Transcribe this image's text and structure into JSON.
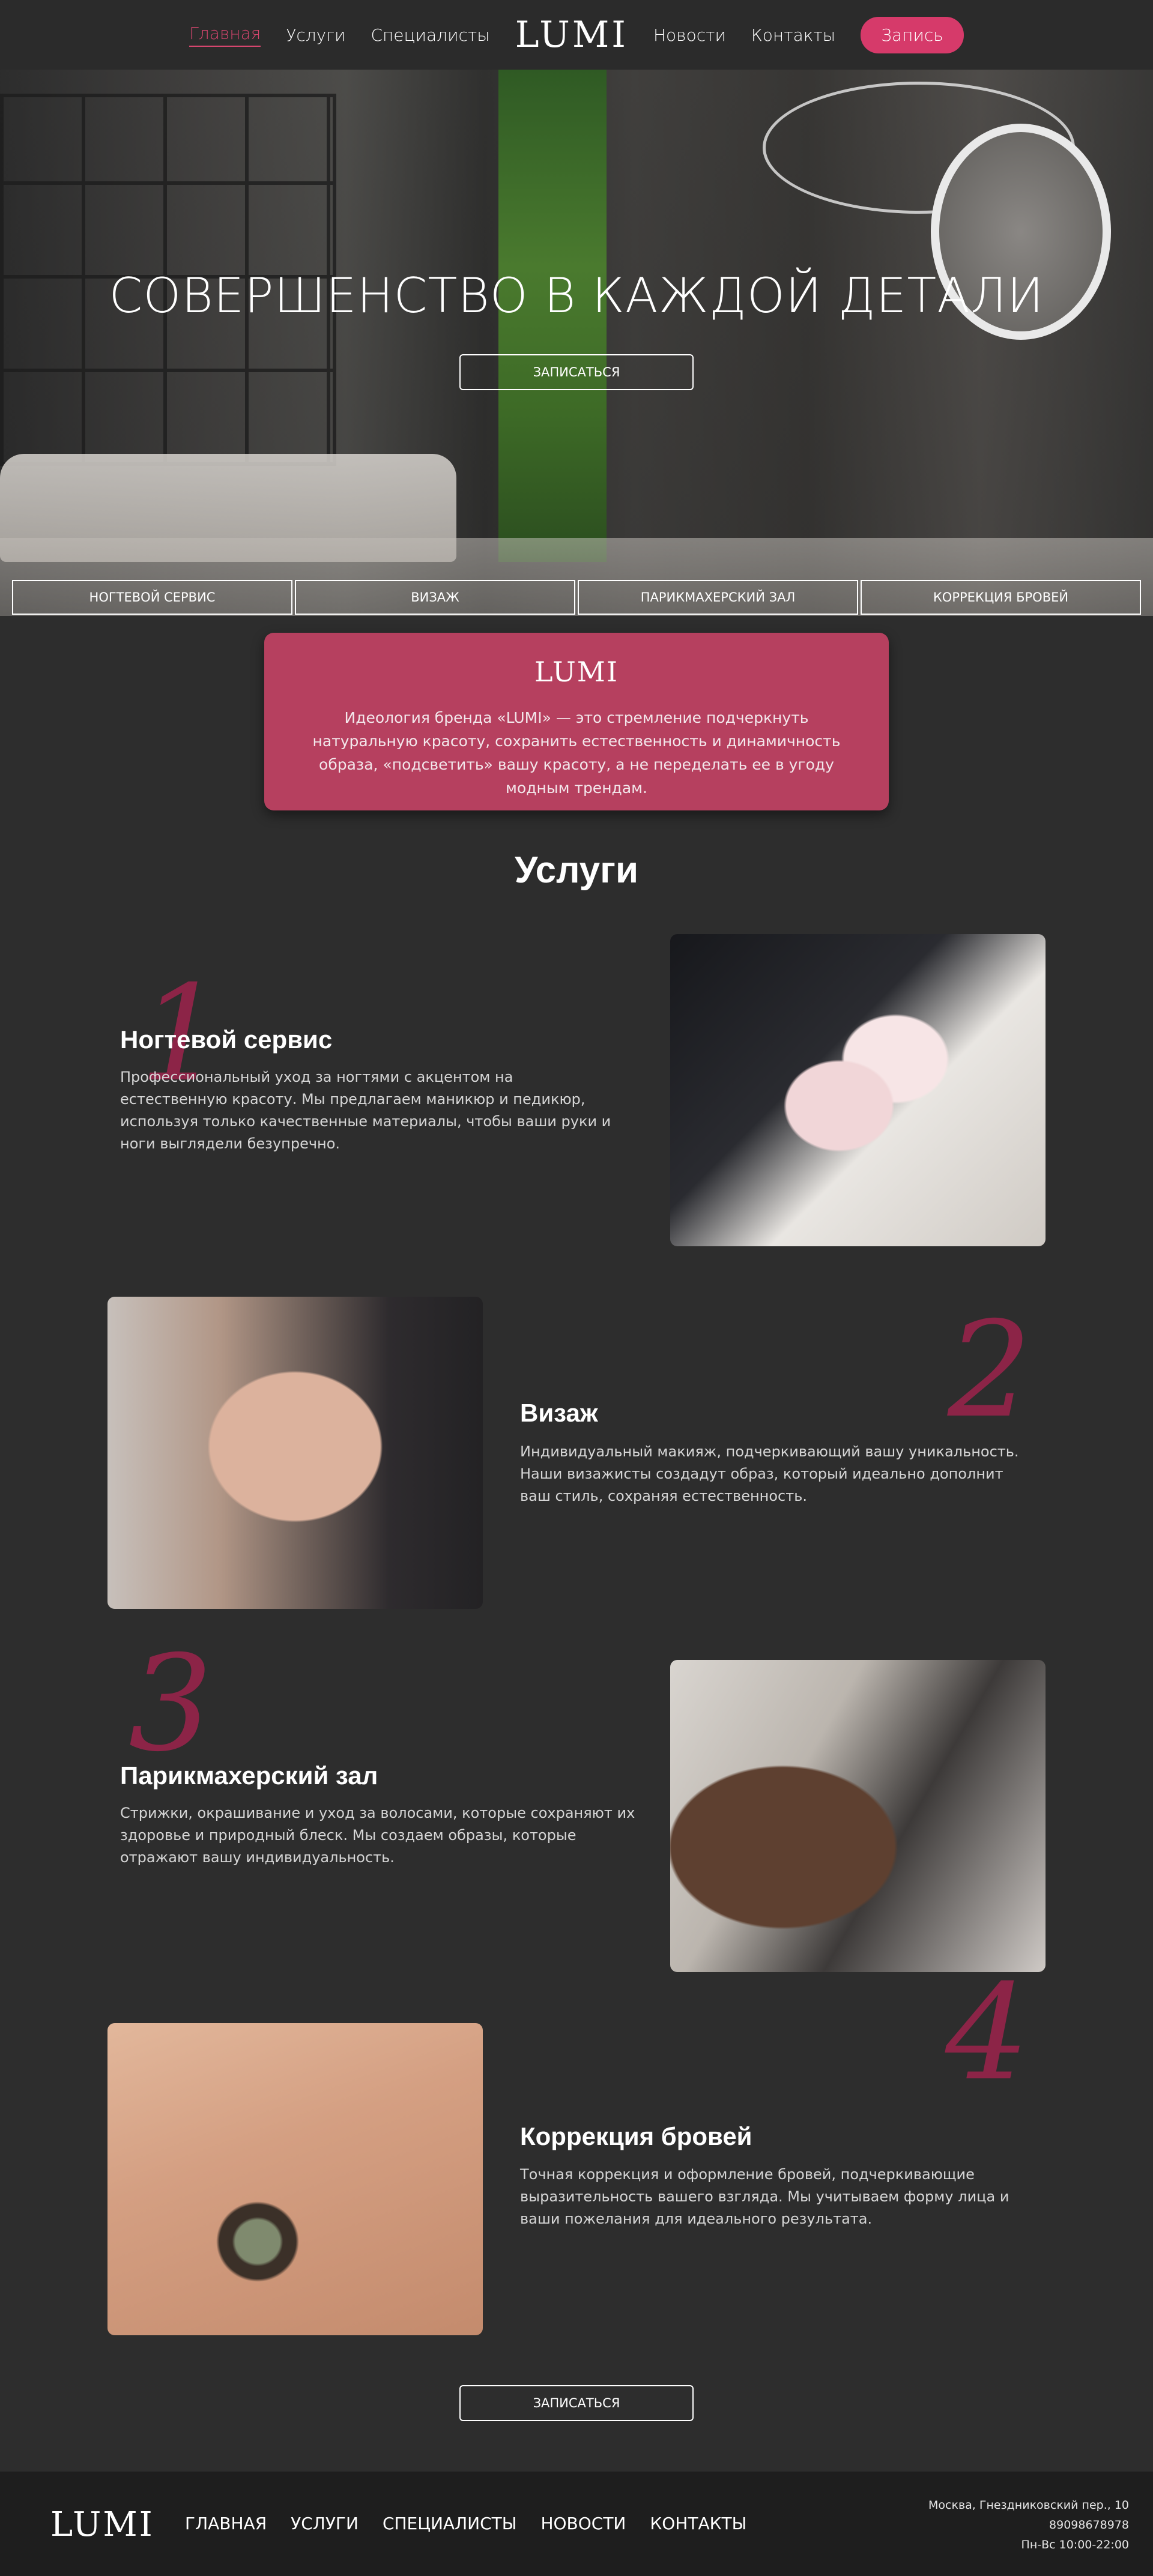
{
  "header": {
    "nav_left": [
      "Главная",
      "Услуги",
      "Специалисты"
    ],
    "logo": "LUMI",
    "nav_right": [
      "Новости",
      "Контакты"
    ],
    "book_button": "Запись"
  },
  "hero": {
    "title": "СОВЕРШЕНСТВО В КАЖДОЙ ДЕТАЛИ",
    "button": "ЗАПИСАТЬСЯ",
    "tabs": [
      "НОГТЕВОЙ СЕРВИС",
      "ВИЗАЖ",
      "ПАРИКМАХЕРСКИЙ ЗАЛ",
      "КОРРЕКЦИЯ БРОВЕЙ"
    ]
  },
  "ideology": {
    "logo": "LUMI",
    "text": "Идеология бренда «LUMI» — это стремление подчеркнуть натуральную красоту, сохранить естественность и динамичность образа, «подсветить» вашу красоту, а не переделать ее в угоду модным трендам."
  },
  "services": {
    "title": "Услуги",
    "items": [
      {
        "num": "1",
        "title": "Ногтевой сервис",
        "desc": "Профессиональный уход за ногтями с акцентом на естественную красоту. Мы предлагаем маникюр и педикюр, используя только качественные материалы, чтобы ваши руки и ноги выглядели безупречно."
      },
      {
        "num": "2",
        "title": "Визаж",
        "desc": "Индивидуальный макияж, подчеркивающий вашу уникальность. Наши визажисты создадут образ, который идеально дополнит ваш стиль, сохраняя естественность."
      },
      {
        "num": "3",
        "title": "Парикмахерский зал",
        "desc": "Стрижки, окрашивание и уход за волосами, которые сохраняют их здоровье и природный блеск. Мы создаем образы, которые отражают вашу индивидуальность."
      },
      {
        "num": "4",
        "title": "Коррекция бровей",
        "desc": "Точная коррекция и оформление бровей, подчеркивающие выразительность вашего взгляда. Мы учитываем форму лица и ваши пожелания для идеального результата."
      }
    ],
    "button": "ЗАПИСАТЬСЯ"
  },
  "footer": {
    "logo": "LUMI",
    "nav": [
      "ГЛАВНАЯ",
      "УСЛУГИ",
      "СПЕЦИАЛИСТЫ",
      "НОВОСТИ",
      "КОНТАКТЫ"
    ],
    "address": "Москва, Гнездниковский пер., 10",
    "phone": "89098678978",
    "hours": "Пн-Вс 10:00-22:00"
  },
  "colors": {
    "accent": "#d63a6a",
    "card": "#b6405f",
    "number": "#8c2447",
    "background": "#2d2d2d"
  }
}
